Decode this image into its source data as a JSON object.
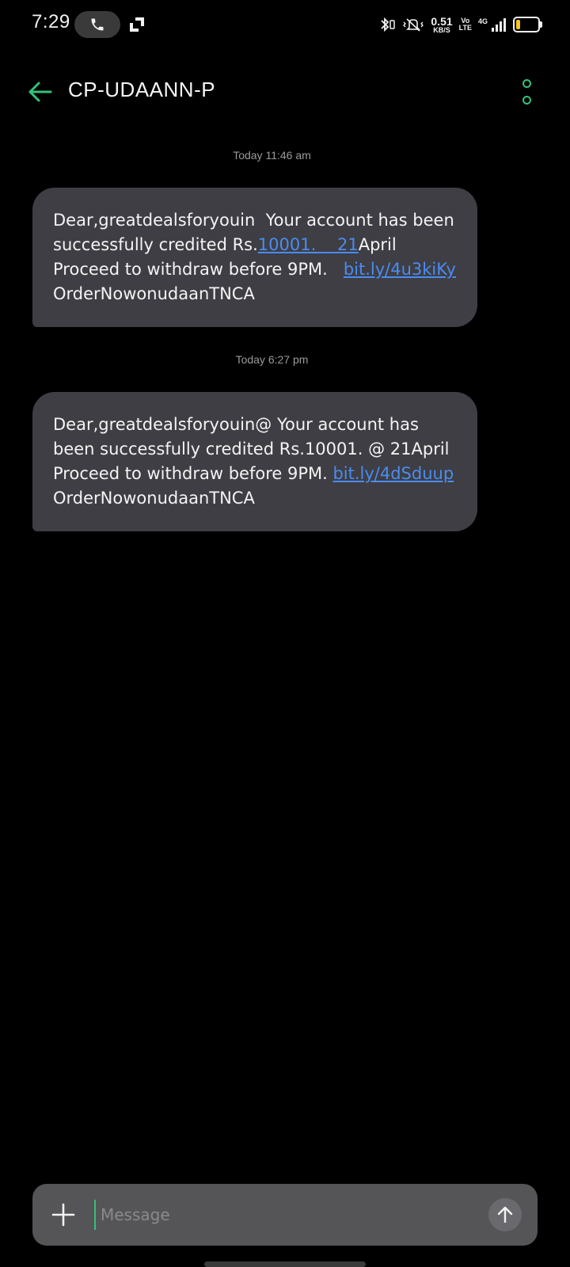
{
  "status_bar": {
    "time": "7:29",
    "net_speed_value": "0.51",
    "net_speed_unit": "KB/S",
    "volte_top": "Vo",
    "volte_bottom": "LTE",
    "network_type": "4G",
    "battery_level": 0.2,
    "battery_color": "#f5c518"
  },
  "header": {
    "title": "CP-UDAANN-P",
    "accent_color": "#36c07a"
  },
  "messages": [
    {
      "timestamp": "Today 11:46 am",
      "parts": [
        {
          "text": "Dear,greatdealsforyouin  Your account has been successfully credited Rs.",
          "link": false
        },
        {
          "text": "10001.    21",
          "link": true
        },
        {
          "text": "April Proceed to withdraw before 9PM.   ",
          "link": false
        },
        {
          "text": "bit.ly/4u3kiKy",
          "link": true
        },
        {
          "text": " OrderNowonudaanTNCA",
          "link": false
        }
      ]
    },
    {
      "timestamp": "Today 6:27 pm",
      "parts": [
        {
          "text": "Dear,greatdealsforyouin@ Your account has been successfully credited Rs.10001. @ 21April Proceed to withdraw before 9PM. ",
          "link": false
        },
        {
          "text": "bit.ly/4dSduup",
          "link": true
        },
        {
          "text": " OrderNowonudaanTNCA",
          "link": false
        }
      ]
    }
  ],
  "compose": {
    "placeholder": "Message",
    "value": ""
  },
  "icons": {
    "call": "phone-icon",
    "cast": "cast-icon",
    "bluetooth": "bluetooth-icon",
    "mute": "vibrate-mute-icon",
    "signal": "signal-icon",
    "battery": "battery-icon",
    "back": "arrow-left-icon",
    "more": "more-vertical-icon",
    "add": "plus-icon",
    "send": "arrow-up-icon"
  }
}
